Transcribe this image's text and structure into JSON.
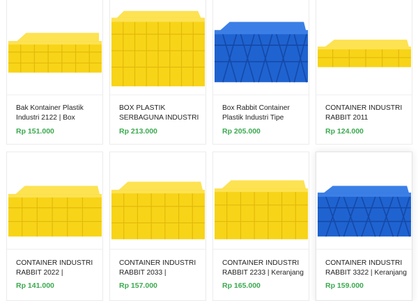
{
  "products": [
    {
      "title": "Bak Kontainer Plastik Industri 2122 | Box",
      "price": "Rp 151.000",
      "color": "yellow",
      "image": "yellow-low-crate"
    },
    {
      "title": "BOX PLASTIK SERBAGUNA INDUSTRI",
      "price": "Rp 213.000",
      "color": "yellow",
      "image": "yellow-tall-crate"
    },
    {
      "title": "Box Rabbit Container Plastik Industri Tipe",
      "price": "Rp 205.000",
      "color": "blue",
      "image": "blue-vented-crate"
    },
    {
      "title": "CONTAINER INDUSTRI RABBIT 2011",
      "price": "Rp 124.000",
      "color": "yellow",
      "image": "yellow-flat-tray"
    },
    {
      "title": "CONTAINER INDUSTRI RABBIT 2022 |",
      "price": "Rp 141.000",
      "color": "yellow",
      "image": "yellow-low-crate"
    },
    {
      "title": "CONTAINER INDUSTRI RABBIT 2033 |",
      "price": "Rp 157.000",
      "color": "yellow",
      "image": "yellow-mid-crate"
    },
    {
      "title": "CONTAINER INDUSTRI RABBIT 2233 | Keranjang",
      "price": "Rp 165.000",
      "color": "yellow",
      "image": "yellow-mid-crate"
    },
    {
      "title": "CONTAINER INDUSTRI RABBIT 3322 | Keranjang",
      "price": "Rp 159.000",
      "color": "blue",
      "image": "blue-vented-crate"
    }
  ],
  "colors": {
    "yellow": "#f7d417",
    "yellow_dark": "#e3b90c",
    "yellow_light": "#fde252",
    "blue": "#1f63d0",
    "blue_dark": "#1449a8",
    "blue_light": "#3b7fe6",
    "price": "#3aaa4f"
  }
}
